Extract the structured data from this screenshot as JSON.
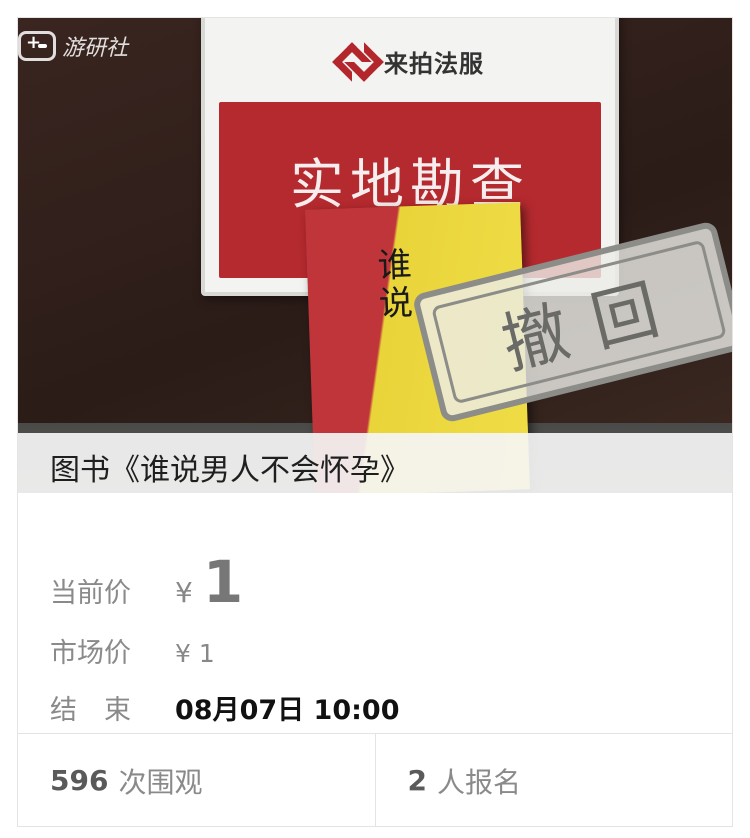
{
  "watermark": {
    "text": "游研社",
    "icon": "gamepad-icon"
  },
  "photo": {
    "sign_brand": "来拍法服",
    "sign_title": "实地勘查",
    "book_title": "谁说",
    "stamp_text": "撤回"
  },
  "item": {
    "title": "图书《谁说男人不会怀孕》"
  },
  "prices": {
    "current_label": "当前价",
    "current_symbol": "¥",
    "current_value": "1",
    "market_label": "市场价",
    "market_value": "¥ 1",
    "end_label": "结　束",
    "end_value": "08月07日 10:00"
  },
  "stats": {
    "views_count": "596",
    "views_label": "次围观",
    "signups_count": "2",
    "signups_label": "人报名"
  },
  "colors": {
    "sign_red": "#b52a2e",
    "book_yellow": "#f0dd46",
    "label_gray": "#8a8a8a"
  }
}
